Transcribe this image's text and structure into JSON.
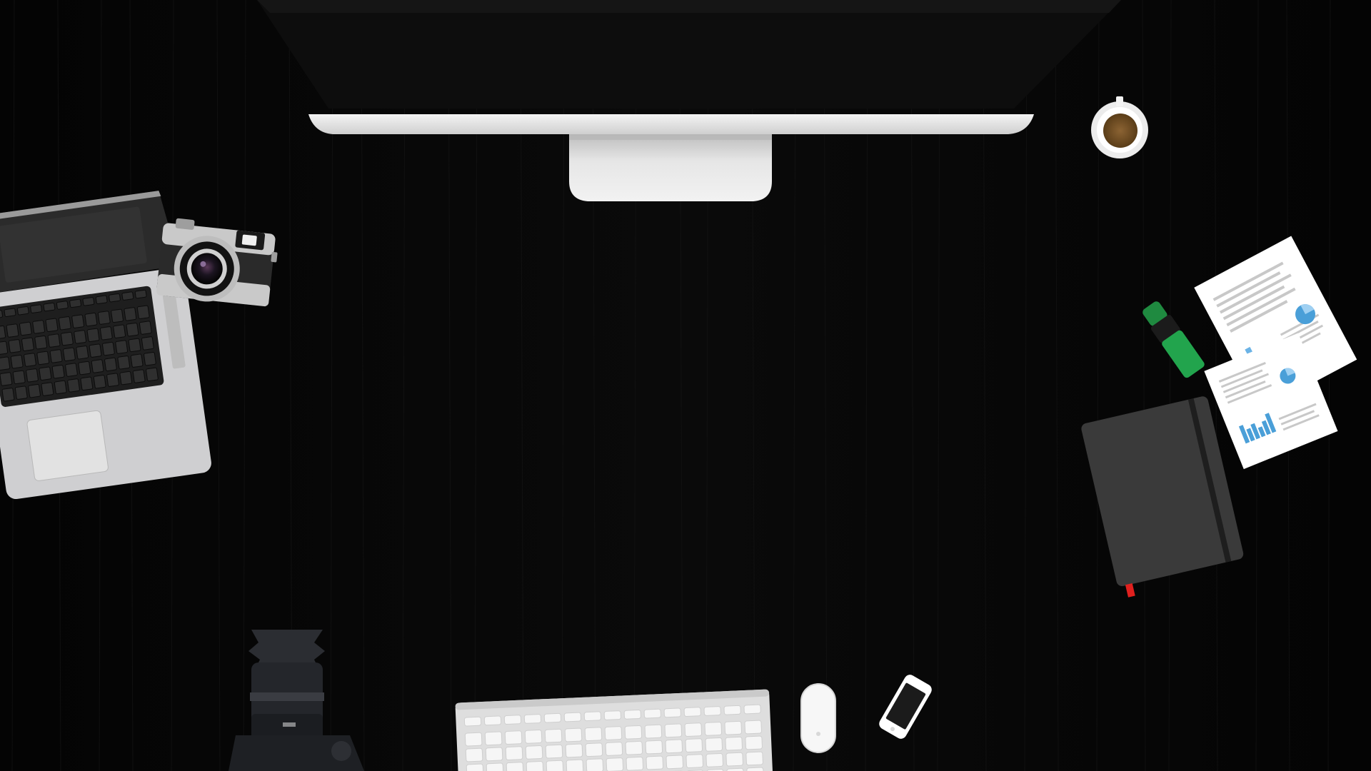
{
  "scene": {
    "background_color": "#060606",
    "wood_grain_color": "#151515",
    "objects": [
      {
        "name": "imac-monitor",
        "icon": "monitor-icon",
        "color": "#0d0d0d",
        "stand_color": "#dcdcdc"
      },
      {
        "name": "coffee-cup",
        "icon": "coffee-cup-icon",
        "color": "#7a5528"
      },
      {
        "name": "macbook-laptop",
        "icon": "laptop-icon",
        "color": "#c8c8ca"
      },
      {
        "name": "rangefinder-camera",
        "icon": "camera-icon",
        "color": "#bdbdbd"
      },
      {
        "name": "highlighter-marker",
        "icon": "highlighter-icon",
        "color": "#1fa64a"
      },
      {
        "name": "report-documents",
        "icon": "document-icon",
        "color": "#ffffff",
        "chart_accent": "#4a9fd8"
      },
      {
        "name": "notebook",
        "icon": "notebook-icon",
        "color": "#3a3a3a",
        "ribbon_color": "#e0201e"
      },
      {
        "name": "dslr-camera",
        "icon": "dslr-camera-icon",
        "color": "#1a1c20"
      },
      {
        "name": "wireless-keyboard",
        "icon": "keyboard-icon",
        "color": "#dedede"
      },
      {
        "name": "magic-mouse",
        "icon": "mouse-icon",
        "color": "#f7f7f7"
      },
      {
        "name": "smartphone",
        "icon": "phone-icon",
        "color": "#ffffff"
      }
    ]
  }
}
